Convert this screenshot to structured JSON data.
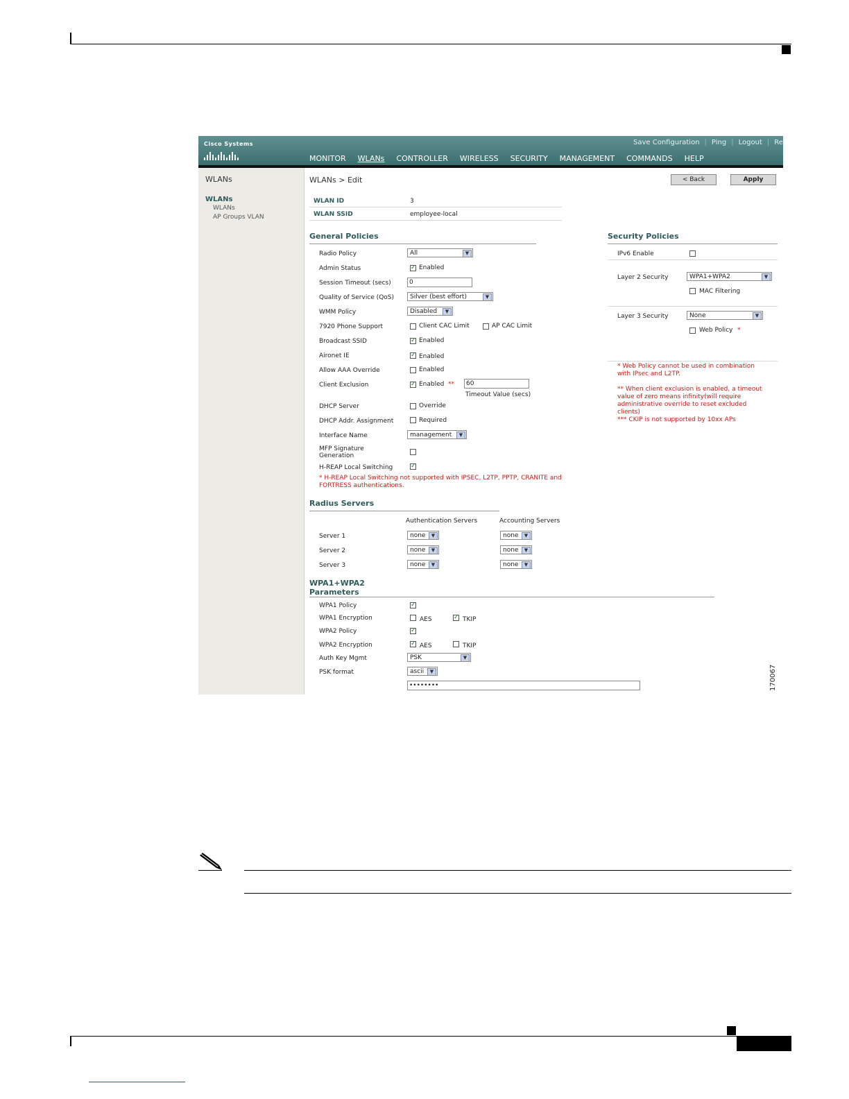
{
  "header": {
    "brand": "Cisco Systems",
    "links": [
      "Save Configuration",
      "Ping",
      "Logout",
      "Refres"
    ],
    "nav": [
      "MONITOR",
      "WLANs",
      "CONTROLLER",
      "WIRELESS",
      "SECURITY",
      "MANAGEMENT",
      "COMMANDS",
      "HELP"
    ],
    "active_nav": "WLANs"
  },
  "sidebar": {
    "title": "WLANs",
    "head": "WLANs",
    "items": [
      "WLANs",
      "AP Groups VLAN"
    ]
  },
  "page": {
    "breadcrumb": "WLANs > Edit",
    "back_label": "< Back",
    "apply_label": "Apply"
  },
  "wlan": {
    "id_label": "WLAN ID",
    "id_value": "3",
    "ssid_label": "WLAN SSID",
    "ssid_value": "employee-local"
  },
  "general": {
    "title": "General Policies",
    "radio_policy": {
      "label": "Radio Policy",
      "value": "All"
    },
    "admin_status": {
      "label": "Admin Status",
      "text": "Enabled",
      "checked": true
    },
    "session_timeout": {
      "label": "Session Timeout (secs)",
      "value": "0"
    },
    "qos": {
      "label": "Quality of Service (QoS)",
      "value": "Silver (best effort)"
    },
    "wmm": {
      "label": "WMM Policy",
      "value": "Disabled"
    },
    "phone": {
      "label": "7920 Phone Support",
      "client_cac": "Client CAC Limit",
      "ap_cac": "AP CAC Limit"
    },
    "broadcast": {
      "label": "Broadcast SSID",
      "text": "Enabled",
      "checked": true
    },
    "aironet": {
      "label": "Aironet IE",
      "text": "Enabled",
      "checked": true
    },
    "aaa": {
      "label": "Allow AAA Override",
      "text": "Enabled",
      "checked": false
    },
    "exclusion": {
      "label": "Client Exclusion",
      "text": "Enabled",
      "mark": "**",
      "timeout": "60",
      "timeout_label": "Timeout Value (secs)",
      "checked": true
    },
    "dhcp_server": {
      "label": "DHCP Server",
      "text": "Override",
      "checked": false
    },
    "dhcp_assign": {
      "label": "DHCP Addr. Assignment",
      "text": "Required",
      "checked": false
    },
    "interface": {
      "label": "Interface Name",
      "value": "management"
    },
    "mfp": {
      "label1": "MFP Signature",
      "label2": "Generation",
      "checked": false
    },
    "hreap": {
      "label": "H-REAP Local Switching",
      "checked": true
    },
    "hreap_note1": "* H-REAP Local Switching not supported with IPSEC, L2TP, PPTP, CRANITE and",
    "hreap_note2": "FORTRESS authentications."
  },
  "security": {
    "title": "Security Policies",
    "ipv6": {
      "label": "IPv6 Enable",
      "checked": false
    },
    "layer2": {
      "label": "Layer 2 Security",
      "value": "WPA1+WPA2",
      "mac": "MAC Filtering"
    },
    "layer3": {
      "label": "Layer 3 Security",
      "value": "None",
      "web": "Web Policy",
      "mark": "*"
    },
    "notes": [
      "* Web Policy cannot be used in combination",
      "with IPsec and L2TP.",
      "** When client exclusion is enabled, a timeout",
      "value of zero means infinity(will require",
      "administrative override to reset excluded",
      "clients)",
      "*** CKIP is not supported by 10xx APs"
    ]
  },
  "radius": {
    "title": "Radius Servers",
    "auth_header": "Authentication Servers",
    "acct_header": "Accounting Servers",
    "servers": [
      {
        "label": "Server 1",
        "auth": "none",
        "acct": "none"
      },
      {
        "label": "Server 2",
        "auth": "none",
        "acct": "none"
      },
      {
        "label": "Server 3",
        "auth": "none",
        "acct": "none"
      }
    ]
  },
  "wpa": {
    "title1": "WPA1+WPA2",
    "title2": "Parameters",
    "wpa1_policy": {
      "label": "WPA1 Policy",
      "checked": true
    },
    "wpa1_enc": {
      "label": "WPA1 Encryption",
      "aes": "AES",
      "tkip": "TKIP",
      "aes_checked": false,
      "tkip_checked": true
    },
    "wpa2_policy": {
      "label": "WPA2 Policy",
      "checked": true
    },
    "wpa2_enc": {
      "label": "WPA2 Encryption",
      "aes": "AES",
      "tkip": "TKIP",
      "aes_checked": true,
      "tkip_checked": false
    },
    "auth_key": {
      "label": "Auth Key Mgmt",
      "value": "PSK"
    },
    "psk_format": {
      "label": "PSK format",
      "value": "ascii"
    },
    "psk_value": "••••••••"
  },
  "figure_id": "170067"
}
